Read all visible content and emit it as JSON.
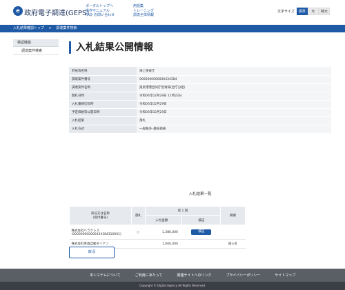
{
  "header": {
    "logo_glyph": "e",
    "site_title": "政府電子調達(GEPS)",
    "links_col1": [
      "ポータルトップへ",
      "操作マニュアル",
      "FAQ･お問い合わせ"
    ],
    "links_col2": [
      "用語集",
      "トレーニング",
      "調達全体情報"
    ],
    "font_size_label": "文字サイズ",
    "font_size_options": [
      "標準",
      "大",
      "特大"
    ],
    "font_size_active": "標準",
    "brand_color": "#1f5aa6"
  },
  "breadcrumb": {
    "items": [
      "入札結果確認トップ",
      "調達案件検索"
    ],
    "separator": ">"
  },
  "sidebar": {
    "heading": "検証機能",
    "items": [
      "調達案件検索"
    ]
  },
  "page_title": "入札結果公開情報",
  "info": {
    "rows": [
      {
        "label": "府省等名称",
        "value": "海上保安庁"
      },
      {
        "label": "調達案件番号",
        "value": "0000000000000434384"
      },
      {
        "label": "調達案件名称",
        "value": "奥尻港港合同庁舎清掃(合庁分担)"
      },
      {
        "label": "開札日時",
        "value": "令和06年02月29日 11時22分"
      },
      {
        "label": "入札書締切日時",
        "value": "令和06年02月29日"
      },
      {
        "label": "予定価格等公開日時",
        "value": "令和06年02月29日"
      },
      {
        "label": "入札結果",
        "value": "落札"
      },
      {
        "label": "入札方式",
        "value": "一般競争･最低価格"
      }
    ]
  },
  "results": {
    "title": "入札結果一覧",
    "headers": {
      "name": "商号又は名称",
      "name_sub": "(受付番号)",
      "fall": "落札",
      "round": "第 1 回",
      "amount": "入札金額",
      "review": "検証",
      "note": "摘要"
    },
    "rows": [
      {
        "name": "株式会社ヘラクレス",
        "number": "(000000000000434384310001)",
        "fall": "○",
        "amount": "1,380,000",
        "review_button": "検証",
        "note": ""
      },
      {
        "name": "株式会社青森自動ダイケン",
        "number": "",
        "fall": "",
        "amount": "1,600,000",
        "review_button": "",
        "note": "辞入札"
      }
    ]
  },
  "back_button": "戻る",
  "footer": {
    "links": [
      "本システムについて",
      "ご利用にあたって",
      "関連サイトへのリンク",
      "プライバシーポリシー",
      "サイトマップ"
    ],
    "copyright": "Copyright © Digital Agency All Rights Reserved."
  }
}
